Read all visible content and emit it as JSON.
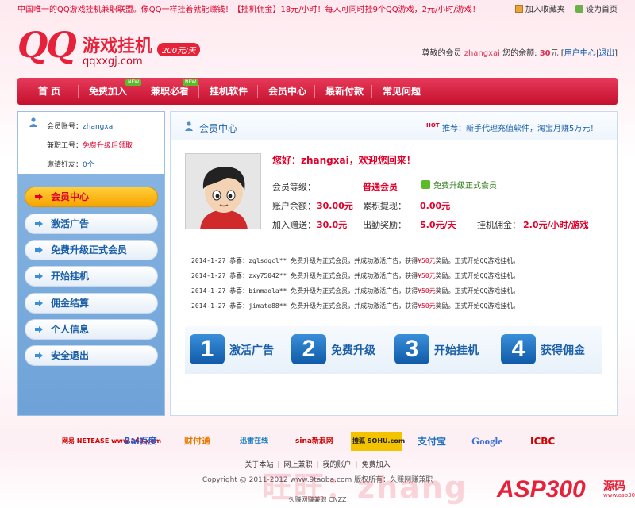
{
  "topbar": {
    "notice": "中国唯一的QQ游戏挂机兼职联盟。像QQ一样挂着就能赚钱！【挂机佣金】18元/小时！每人可同时挂9个QQ游戏，2元/小时/游戏！",
    "favorite_label": "加入收藏夹",
    "homepage_label": "设为首页"
  },
  "logo": {
    "qq": "QQ",
    "name": "游戏挂机",
    "domain": "qqxxgj.com",
    "price_badge": "200元/天"
  },
  "userinfo": {
    "greeting_prefix": "尊敬的会员",
    "username": "zhangxai",
    "balance_prefix": "您的余额:",
    "balance": "30",
    "balance_unit": "元",
    "user_center_link": "用户中心",
    "logout_link": "退出"
  },
  "nav": {
    "items": [
      "首 页",
      "免费加入",
      "兼职必看",
      "挂机软件",
      "会员中心",
      "最新付款",
      "常见问题"
    ],
    "new_badge": "NEW"
  },
  "sidebar": {
    "account_label": "会员账号：",
    "account_value": "zhangxai",
    "job_id_label": "兼职工号：",
    "job_id_value": "免费升级后领取",
    "invite_label": "邀请好友：",
    "invite_value": "0个",
    "menu": [
      "会员中心",
      "激活广告",
      "免费升级正式会员",
      "开始挂机",
      "佣金结算",
      "个人信息",
      "安全退出"
    ],
    "active_index": 0
  },
  "main": {
    "title": "会员中心",
    "hot_badge": "HOT",
    "recommend": "推荐：新手代理充值软件，淘宝月赚5万元！",
    "welcome": "您好：zhangxai，欢迎您回来！",
    "stats": {
      "level_label": "会员等级：",
      "level_value": "普通会员",
      "upgrade_label": "免费升级正式会员",
      "balance_label": "账户余额：",
      "balance_value": "30.00元",
      "withdrawn_label": "累积提现：",
      "withdrawn_value": "0.00元",
      "bonus_label": "加入赠送：",
      "bonus_value": "30.0元",
      "attendance_label": "出勤奖励：",
      "attendance_value": "5.0元/天",
      "commission_label": "挂机佣金：",
      "commission_value": "2.0元/小时/游戏"
    },
    "logs": [
      {
        "date": "2014-1-27",
        "user": "zglsdqcl**",
        "pre": "恭喜：",
        "mid": " 免费升级为正式会员，并成功激活广告，获得",
        "amount": "¥50元",
        "post": "奖励。正式开始QQ游戏挂机。"
      },
      {
        "date": "2014-1-27",
        "user": "zxy75042**",
        "pre": "恭喜：",
        "mid": " 免费升级为正式会员，并成功激活广告，获得",
        "amount": "¥50元",
        "post": "奖励。正式开始QQ游戏挂机。"
      },
      {
        "date": "2014-1-27",
        "user": "binmaola**",
        "pre": "恭喜：",
        "mid": " 免费升级为正式会员，并成功激活广告，获得",
        "amount": "¥50元",
        "post": "奖励。正式开始QQ游戏挂机。"
      },
      {
        "date": "2014-1-27",
        "user": "jimate88**",
        "pre": "恭喜：",
        "mid": " 免费升级为正式会员，并成功激活广告，获得",
        "amount": "¥50元",
        "post": "奖励。正式开始QQ游戏挂机。"
      }
    ],
    "steps": [
      {
        "num": "1",
        "label": "激活广告"
      },
      {
        "num": "2",
        "label": "免费升级"
      },
      {
        "num": "3",
        "label": "开始挂机"
      },
      {
        "num": "4",
        "label": "获得佣金"
      }
    ]
  },
  "partners": [
    "网易 NETEASE www.163.com",
    "Bai百度",
    "财付通",
    "迅雷在线",
    "sina新浪网",
    "搜狐 SOHU.com",
    "支付宝",
    "Google",
    "ICBC"
  ],
  "footer": {
    "links": [
      "关于本站",
      "网上兼职",
      "我的账户",
      "免费加入"
    ],
    "copyright": "Copyright @ 2011-2012 www.9taoba.com 版权所有：久赚网赚兼职",
    "tagline": "久赚网赚兼职",
    "tag_badge": "CNZZ",
    "watermark": "旺旺：zhang",
    "asp_logo": "ASP300",
    "asp_yuan": "源码",
    "asp_domain": "www.asp300.com"
  },
  "colors": {
    "brand_red": "#e6223b",
    "nav_red": "#c4102e",
    "link_blue": "#1a5fa8",
    "active_orange": "#f6a400"
  }
}
